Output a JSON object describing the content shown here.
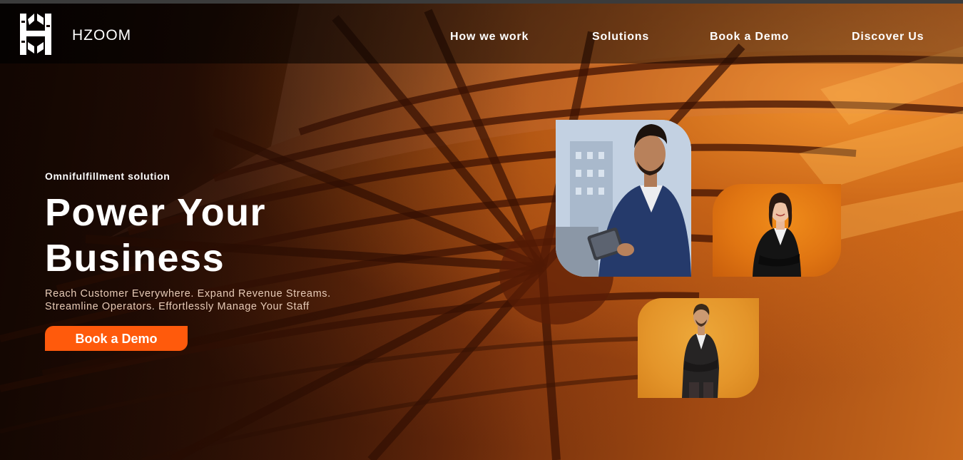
{
  "brand": {
    "name": "HZOOM",
    "logo_icon": "hzoom-logo-icon"
  },
  "nav": {
    "items": [
      {
        "label": "How we work"
      },
      {
        "label": "Solutions"
      },
      {
        "label": "Book a Demo"
      },
      {
        "label": "Discover Us"
      }
    ]
  },
  "hero": {
    "eyebrow": "Omnifulfillment solution",
    "headline_line1": "Power Your",
    "headline_line2": "Business",
    "sub_line1": "Reach Customer Everywhere. Expand Revenue Streams.",
    "sub_line2": "Streamline Operators. Effortlessly Manage Your Staff",
    "cta_label": "Book a Demo"
  },
  "colors": {
    "accent": "#ff5a0c",
    "orange_card": "#e07512",
    "amber_card": "#e4952a",
    "text_muted": "#e7cbb7"
  },
  "images": [
    {
      "name": "businessman-with-tablet-photo"
    },
    {
      "name": "businesswoman-arms-crossed-photo"
    },
    {
      "name": "businessman-arms-crossed-photo"
    }
  ]
}
